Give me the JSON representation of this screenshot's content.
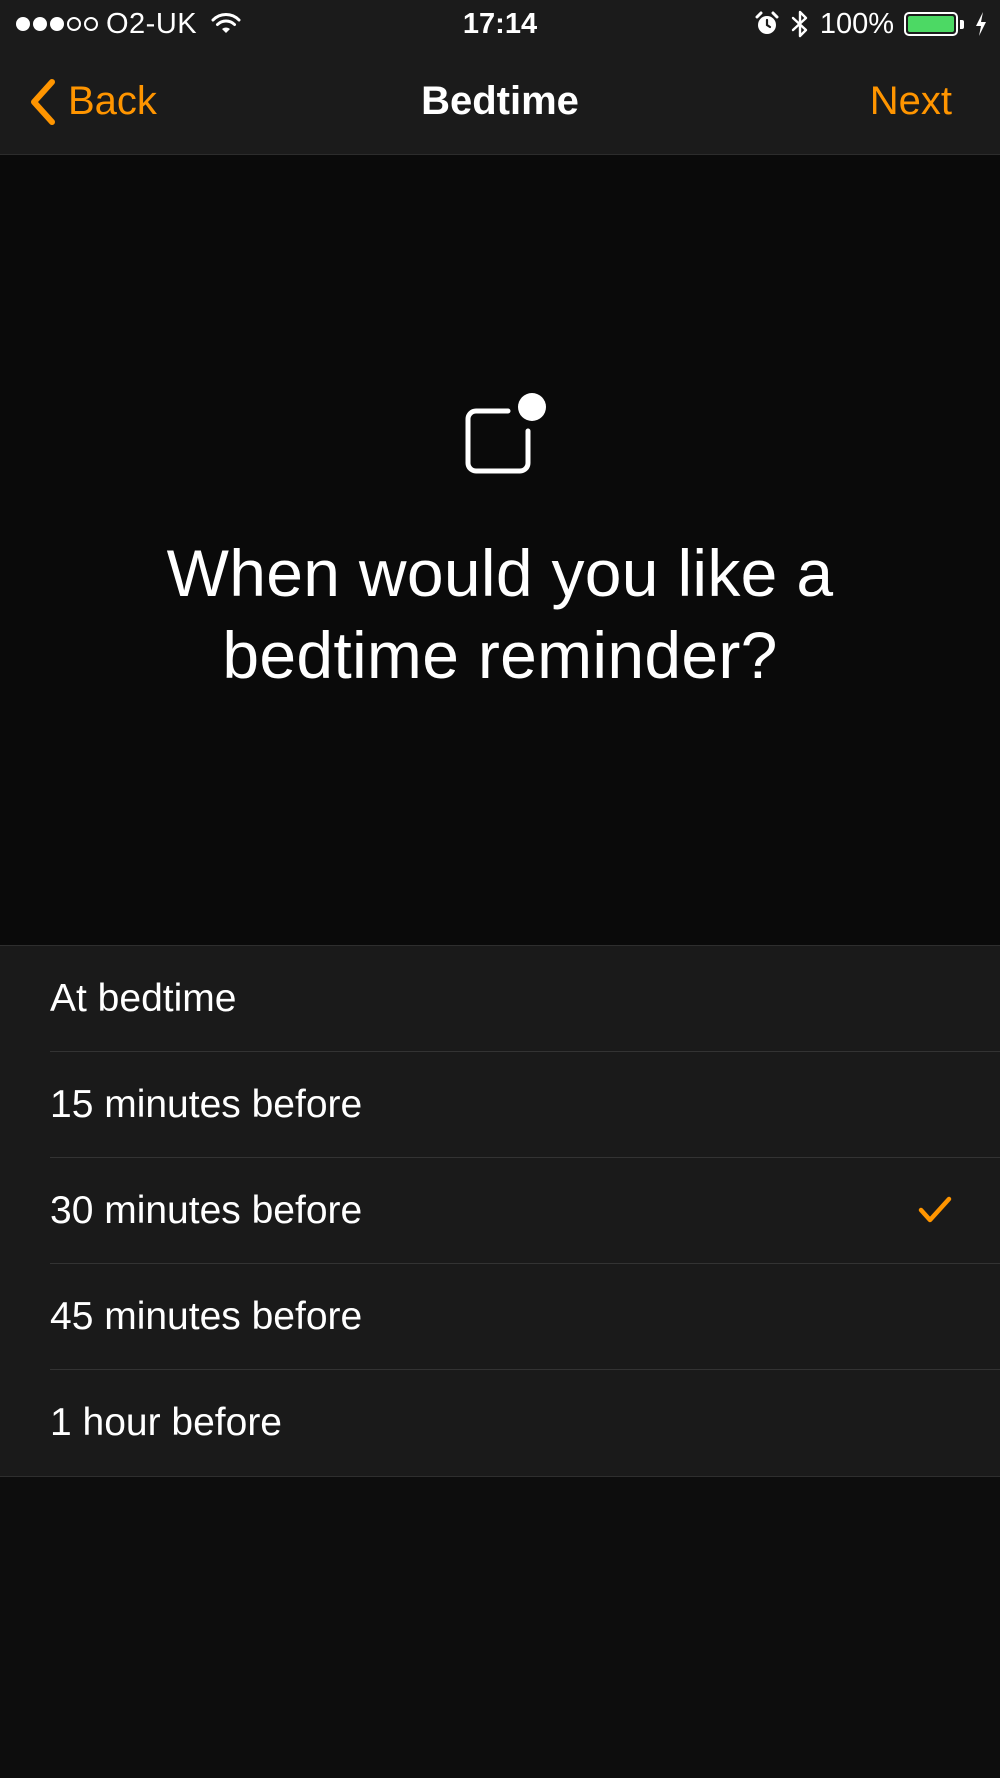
{
  "status_bar": {
    "carrier": "O2-UK",
    "signal_filled": 3,
    "signal_total": 5,
    "time": "17:14",
    "battery_percent": "100%",
    "battery_color": "#4cd964"
  },
  "nav": {
    "back_label": "Back",
    "title": "Bedtime",
    "next_label": "Next",
    "accent_color": "#ff9500"
  },
  "hero": {
    "icon": "notification-badge-icon",
    "question_line1": "When would you like a",
    "question_line2": "bedtime reminder?"
  },
  "options": [
    {
      "label": "At bedtime",
      "selected": false
    },
    {
      "label": "15 minutes before",
      "selected": false
    },
    {
      "label": "30 minutes before",
      "selected": true
    },
    {
      "label": "45 minutes before",
      "selected": false
    },
    {
      "label": "1 hour before",
      "selected": false
    }
  ]
}
